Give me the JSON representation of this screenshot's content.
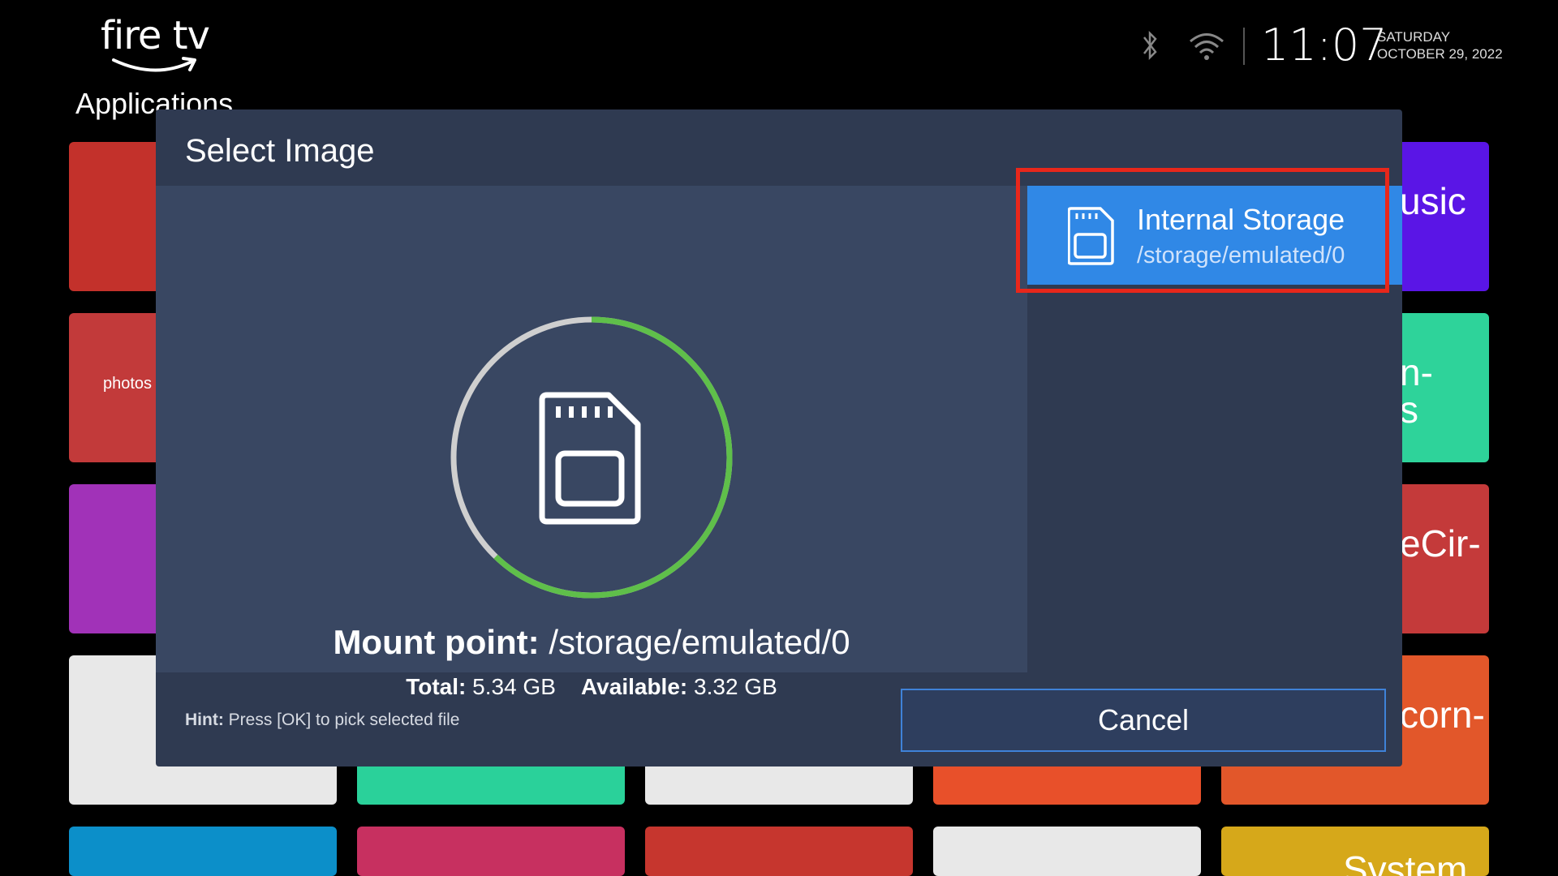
{
  "header": {
    "logo_text": "fire tv",
    "section_title": "Applications",
    "time": "11:07",
    "day": "SATURDAY",
    "date": "OCTOBER 29, 2022",
    "icons": [
      "bluetooth-icon",
      "wifi-icon"
    ]
  },
  "tiles": [
    {
      "label": "",
      "color": "#c3312b"
    },
    {
      "label": "usic",
      "color": "#5a15e6"
    },
    {
      "label": "photos",
      "color": "#c23a3a"
    },
    {
      "label": "n-\ns",
      "color": "#2ed39a"
    },
    {
      "label": "",
      "color": "#a132b8"
    },
    {
      "label": "eCir-",
      "color": "#c43a3a"
    },
    {
      "label": "",
      "color": "#e8e8e8"
    },
    {
      "label": "",
      "color": "#2ad19a"
    },
    {
      "label": "",
      "color": "#e8e8e8"
    },
    {
      "label": "",
      "color": "#e8502a"
    },
    {
      "label": "corn-",
      "color": "#e2572a"
    },
    {
      "label": "",
      "color": "#0c8fc9"
    },
    {
      "label": "",
      "color": "#c73060"
    },
    {
      "label": "",
      "color": "#c6362e"
    },
    {
      "label": "",
      "color": "#e8e8e8"
    },
    {
      "label": "System",
      "color": "#d6a81a"
    }
  ],
  "dialog": {
    "title": "Select Image",
    "storage": {
      "name": "Internal Storage",
      "path": "/storage/emulated/0",
      "icon": "sd-card-icon"
    },
    "mount_label": "Mount point:",
    "mount_value": "/storage/emulated/0",
    "total_label": "Total:",
    "total_value": "5.34 GB",
    "available_label": "Available:",
    "available_value": "3.32 GB",
    "used_fraction": 0.378,
    "hint_label": "Hint:",
    "hint_text": "Press [OK] to pick selected file",
    "cancel_label": "Cancel"
  },
  "colors": {
    "accent_blue": "#3088e6",
    "ring_green": "#5fbf4a",
    "ring_gray": "#cfcfcf",
    "highlight_red": "#e8271b"
  }
}
